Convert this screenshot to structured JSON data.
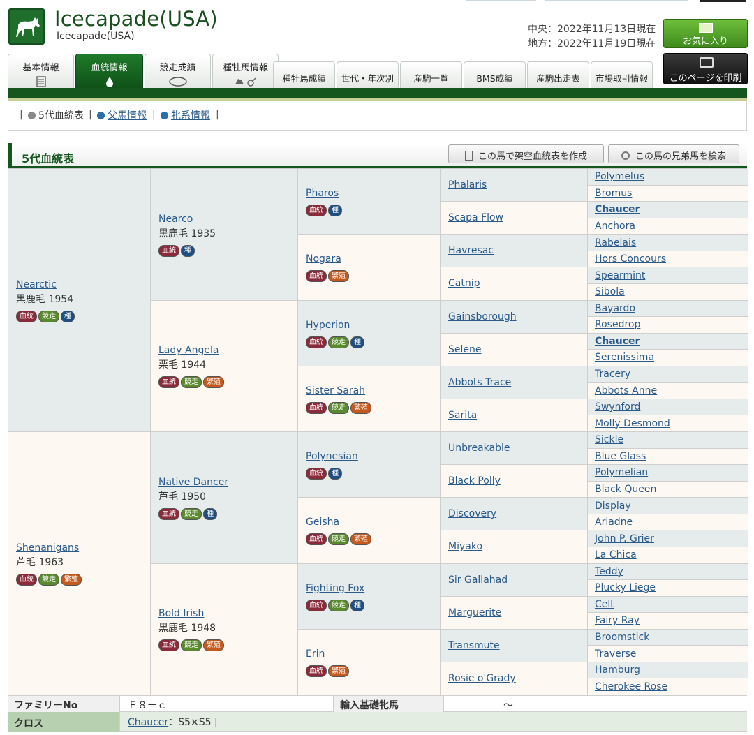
{
  "header": {
    "title": "Icecapade(USA)",
    "subtitle": "Icecapade(USA)",
    "date_central": "中央：2022年11月13日現在",
    "date_local": "地方：2022年11月19日現在",
    "fav_label": "お気に入り",
    "print_label": "このページを印刷",
    "logo_icon": "horse-icon"
  },
  "tabs": [
    {
      "label": "基本情報",
      "active": false
    },
    {
      "label": "血統情報",
      "active": true
    },
    {
      "label": "競走成績",
      "active": false
    },
    {
      "label": "種牡馬情報",
      "active": false
    },
    {
      "label": "種牡馬成績",
      "active": false
    },
    {
      "label": "世代・年次別",
      "active": false
    },
    {
      "label": "産駒一覧",
      "active": false
    },
    {
      "label": "BMS成績",
      "active": false
    },
    {
      "label": "産駒出走表",
      "active": false
    },
    {
      "label": "市場取引情報",
      "active": false
    }
  ],
  "subnav": {
    "current": "5代血統表",
    "sire_info": "父馬情報",
    "line_info": "牝系情報"
  },
  "section": {
    "title": "5代血統表",
    "create_button": "この馬で架空血統表を作成",
    "sibling_button": "この馬の兄弟馬を検索"
  },
  "badges": {
    "bloodline": "血統",
    "race": "競走",
    "sire": "種",
    "breed": "繁殖"
  },
  "pedigree": {
    "g1": [
      {
        "name": "Nearctic",
        "color": "黒鹿毛 1954",
        "badges": [
          "bloodline",
          "race",
          "sire"
        ]
      },
      {
        "name": "Shenanigans",
        "color": "芦毛 1963",
        "badges": [
          "bloodline",
          "race",
          "breed"
        ]
      }
    ],
    "g2": [
      {
        "name": "Nearco",
        "color": "黒鹿毛 1935",
        "badges": [
          "bloodline",
          "sire"
        ]
      },
      {
        "name": "Lady Angela",
        "color": "栗毛 1944",
        "badges": [
          "bloodline",
          "race",
          "breed"
        ]
      },
      {
        "name": "Native Dancer",
        "color": "芦毛 1950",
        "badges": [
          "bloodline",
          "race",
          "sire"
        ]
      },
      {
        "name": "Bold Irish",
        "color": "黒鹿毛 1948",
        "badges": [
          "bloodline",
          "race",
          "breed"
        ]
      }
    ],
    "g3": [
      {
        "name": "Pharos",
        "badges": [
          "bloodline",
          "sire"
        ]
      },
      {
        "name": "Nogara",
        "badges": [
          "bloodline",
          "breed"
        ]
      },
      {
        "name": "Hyperion",
        "badges": [
          "bloodline",
          "race",
          "sire"
        ]
      },
      {
        "name": "Sister Sarah",
        "badges": [
          "bloodline",
          "race",
          "breed"
        ]
      },
      {
        "name": "Polynesian",
        "badges": [
          "bloodline",
          "sire"
        ]
      },
      {
        "name": "Geisha",
        "badges": [
          "bloodline",
          "race",
          "breed"
        ]
      },
      {
        "name": "Fighting Fox",
        "badges": [
          "bloodline",
          "race",
          "sire"
        ]
      },
      {
        "name": "Erin",
        "badges": [
          "bloodline",
          "breed"
        ]
      }
    ],
    "g4": [
      "Phalaris",
      "Scapa Flow",
      "Havresac",
      "Catnip",
      "Gainsborough",
      "Selene",
      "Abbots Trace",
      "Sarita",
      "Unbreakable",
      "Black Polly",
      "Discovery",
      "Miyako",
      "Sir Gallahad",
      "Marguerite",
      "Transmute",
      "Rosie o'Grady"
    ],
    "g5": [
      "Polymelus",
      "Bromus",
      "Chaucer",
      "Anchora",
      "Rabelais",
      "Hors Concours",
      "Spearmint",
      "Sibola",
      "Bayardo",
      "Rosedrop",
      "Chaucer",
      "Serenissima",
      "Tracery",
      "Abbots Anne",
      "Swynford",
      "Molly Desmond",
      "Sickle",
      "Blue Glass",
      "Polymelian",
      "Black Queen",
      "Display",
      "Ariadne",
      "John P. Grier",
      "La Chica",
      "Teddy",
      "Plucky Liege",
      "Celt",
      "Fairy Ray",
      "Broomstick",
      "Traverse",
      "Hamburg",
      "Cherokee Rose"
    ]
  },
  "footer": {
    "family_label": "ファミリーNo",
    "family_value": "Ｆ８ーｃ",
    "import_label": "輸入基礎牝馬",
    "import_value": "～",
    "cross_label": "クロス",
    "cross_horse": "Chaucer",
    "cross_detail": "：S5×S5 |"
  }
}
